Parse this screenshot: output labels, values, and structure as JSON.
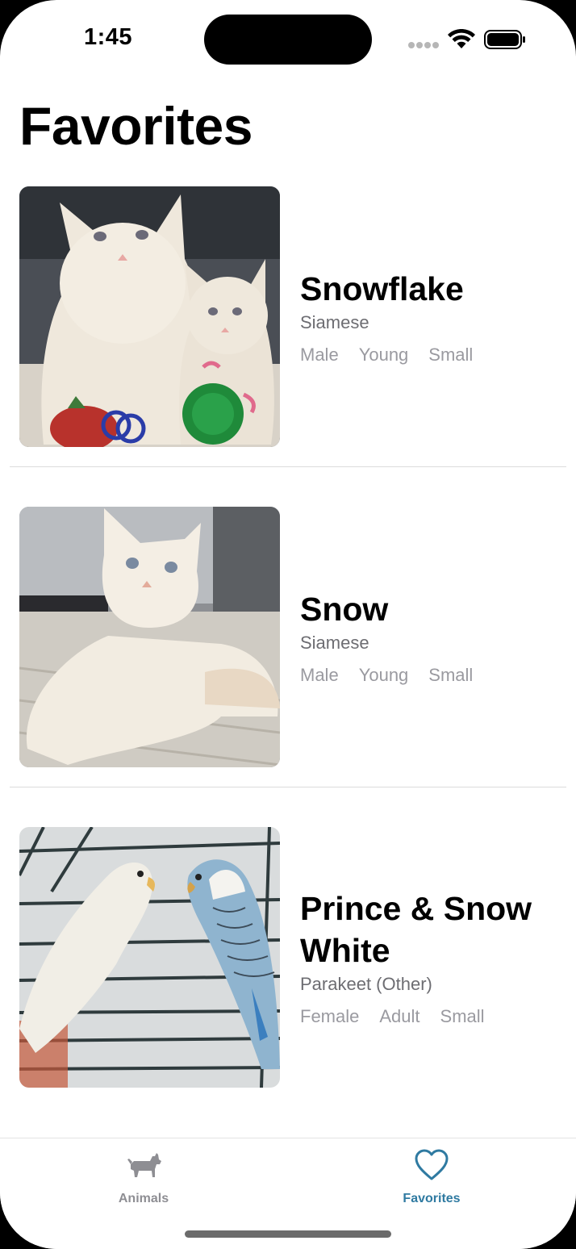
{
  "status_bar": {
    "time": "1:45"
  },
  "page": {
    "title": "Favorites"
  },
  "pets": [
    {
      "name": "Snowflake",
      "breed": "Siamese",
      "tags": [
        "Male",
        "Young",
        "Small"
      ]
    },
    {
      "name": "Snow",
      "breed": "Siamese",
      "tags": [
        "Male",
        "Young",
        "Small"
      ]
    },
    {
      "name": "Prince & Snow White",
      "breed": "Parakeet (Other)",
      "tags": [
        "Female",
        "Adult",
        "Small"
      ]
    }
  ],
  "tabbar": {
    "tabs": [
      {
        "label": "Animals",
        "icon": "dog-icon",
        "selected": false
      },
      {
        "label": "Favorites",
        "icon": "heart-icon",
        "selected": true
      }
    ]
  },
  "colors": {
    "accent": "#2f7aa1",
    "inactive": "#8e8e93"
  }
}
